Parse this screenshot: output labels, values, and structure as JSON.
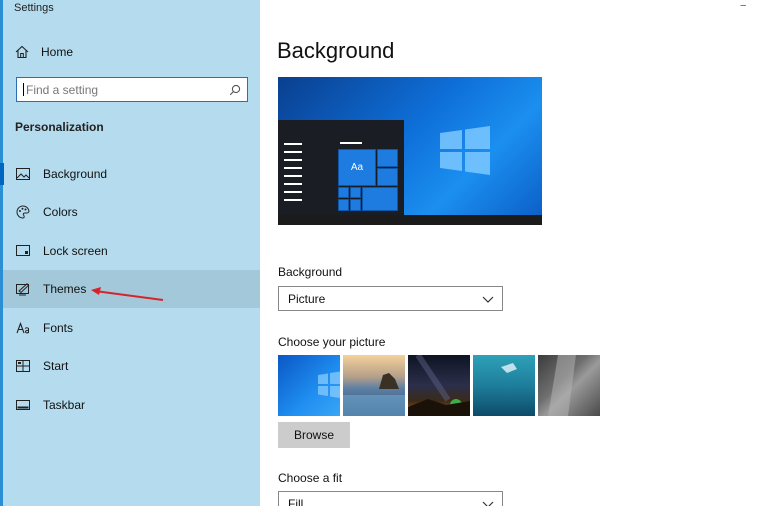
{
  "window": {
    "title": "Settings"
  },
  "sidebar": {
    "home_label": "Home",
    "search_placeholder": "Find a setting",
    "section_title": "Personalization",
    "items": [
      {
        "label": "Background",
        "icon": "picture-icon",
        "selected": true
      },
      {
        "label": "Colors",
        "icon": "palette-icon"
      },
      {
        "label": "Lock screen",
        "icon": "lock-screen-icon"
      },
      {
        "label": "Themes",
        "icon": "themes-icon",
        "hovered": true
      },
      {
        "label": "Fonts",
        "icon": "fonts-icon"
      },
      {
        "label": "Start",
        "icon": "start-icon"
      },
      {
        "label": "Taskbar",
        "icon": "taskbar-icon"
      }
    ]
  },
  "main": {
    "title": "Background",
    "preview": {
      "tile_text": "Aa"
    },
    "background_label": "Background",
    "background_value": "Picture",
    "choose_picture_label": "Choose your picture",
    "browse_label": "Browse",
    "fit_label": "Choose a fit",
    "fit_value": "Fill"
  },
  "colors": {
    "accent": "#0067c0",
    "sidebar_bg": "#b5dcee",
    "annotation_arrow": "#d8232a"
  }
}
